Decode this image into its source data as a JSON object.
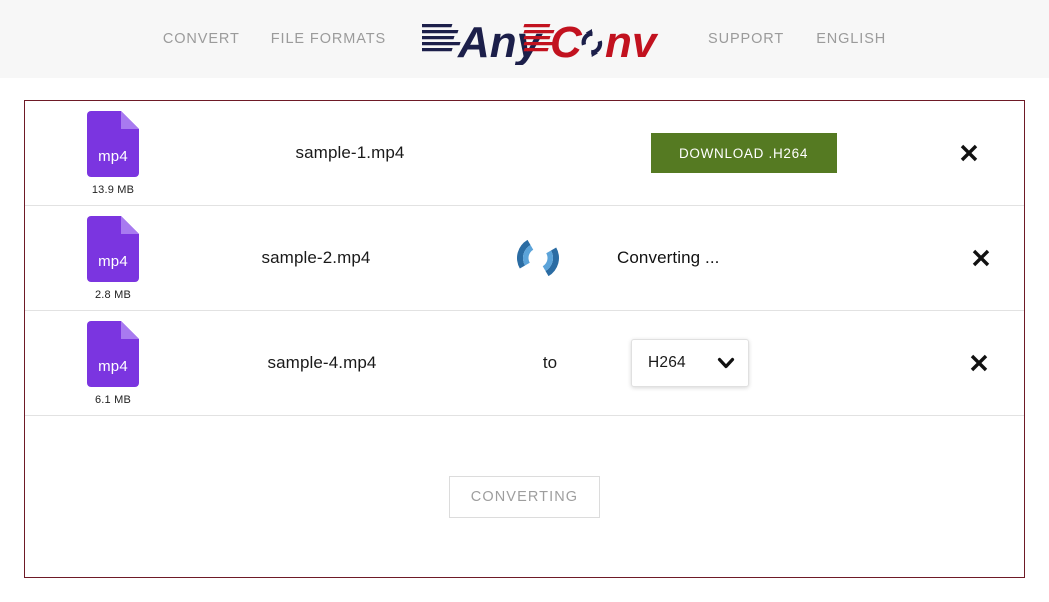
{
  "header": {
    "nav_left": [
      {
        "label": "CONVERT",
        "name": "nav-convert"
      },
      {
        "label": "FILE FORMATS",
        "name": "nav-file-formats"
      }
    ],
    "nav_right": [
      {
        "label": "SUPPORT",
        "name": "nav-support"
      },
      {
        "label": "ENGLISH",
        "name": "nav-english"
      }
    ],
    "logo": {
      "text_primary": "Any",
      "text_secondary": "Conv",
      "color_primary": "#1c1f4a",
      "color_secondary": "#c2121f",
      "icon": "refresh-circular-arrows-icon"
    },
    "background": "#f7f7f7",
    "nav_color": "#9b9b9b"
  },
  "panel": {
    "border_color": "#6e1a26",
    "rows": [
      {
        "icon_name": "file-mp4-icon",
        "icon_ext": "mp4",
        "icon_color": "#7b35e0",
        "size": "13.9 MB",
        "filename": "sample-1.mp4",
        "middle": "",
        "state": "done",
        "download_label": "DOWNLOAD .H264",
        "download_color": "#557a22",
        "close_icon": "close-x-icon"
      },
      {
        "icon_name": "file-mp4-icon",
        "icon_ext": "mp4",
        "icon_color": "#7b35e0",
        "size": "2.8 MB",
        "filename": "sample-2.mp4",
        "middle": "",
        "state": "converting",
        "spinner_icon": "loading-spinner-icon",
        "status_label": "Converting ...",
        "close_icon": "close-x-icon"
      },
      {
        "icon_name": "file-mp4-icon",
        "icon_ext": "mp4",
        "icon_color": "#7b35e0",
        "size": "6.1 MB",
        "filename": "sample-4.mp4",
        "middle": "to",
        "state": "pending",
        "format_value": "H264",
        "chevron_icon": "chevron-down-icon",
        "close_icon": "close-x-icon"
      }
    ],
    "footer": {
      "convert_label": "CONVERTING",
      "convert_text_color": "#9e9e9e",
      "convert_border_color": "#dcdcdc"
    }
  }
}
